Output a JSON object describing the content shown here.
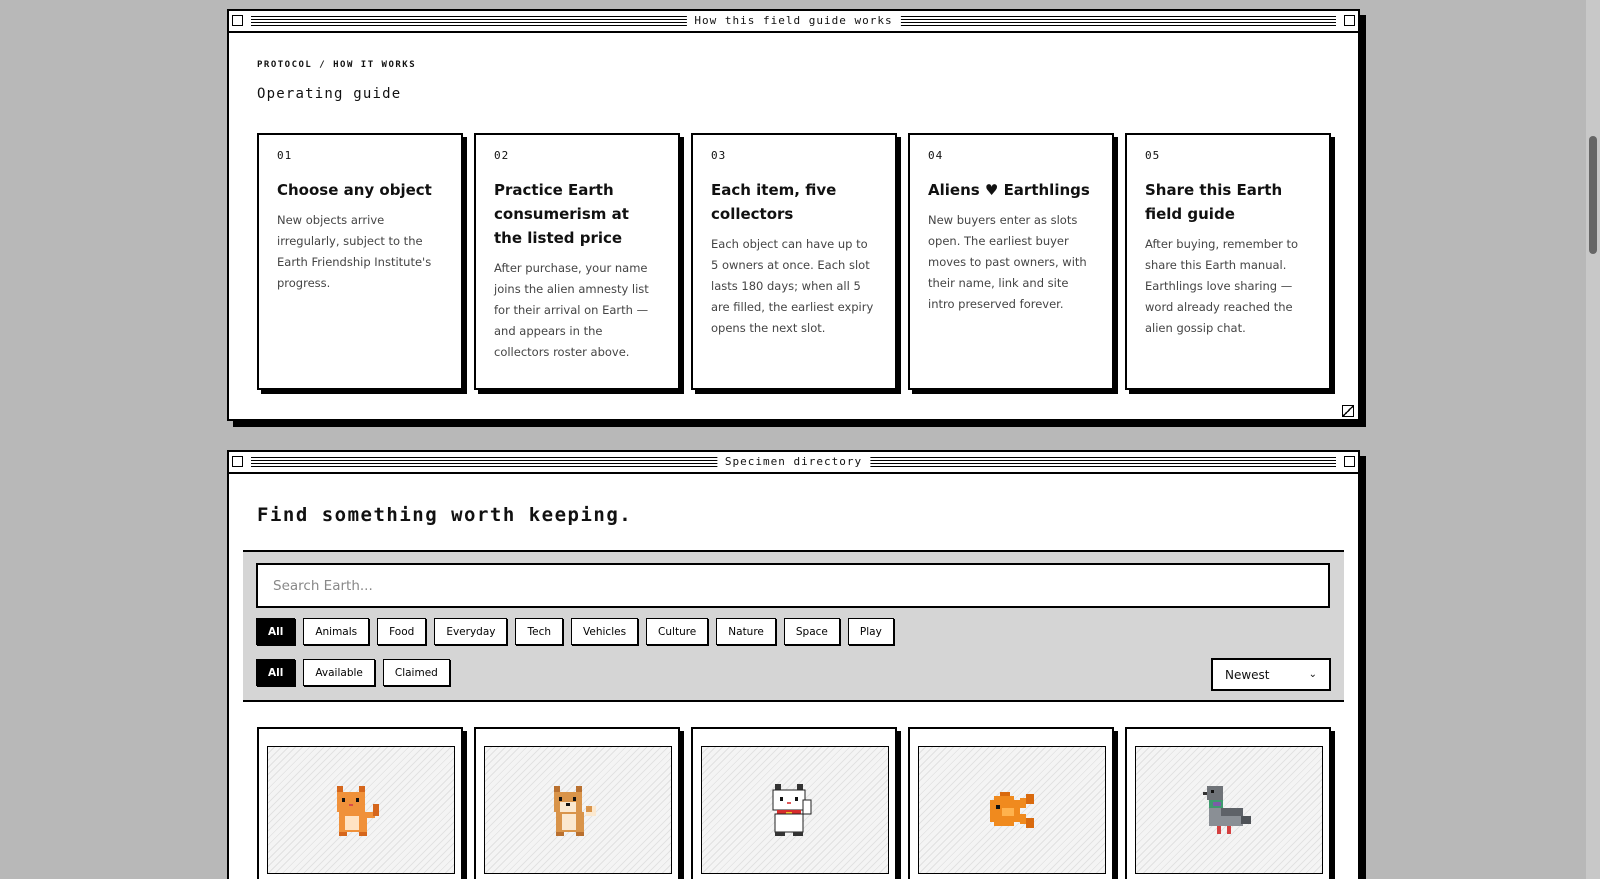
{
  "guide_window": {
    "title": "How this field guide works",
    "eyebrow": "PROTOCOL / HOW IT WORKS",
    "heading": "Operating guide",
    "steps": [
      {
        "num": "01",
        "title": "Choose any object",
        "body": "New objects arrive irregularly, subject to the Earth Friendship Institute's progress."
      },
      {
        "num": "02",
        "title": "Practice Earth consumerism at the listed price",
        "body": "After purchase, your name joins the alien amnesty list for their arrival on Earth — and appears in the collectors roster above."
      },
      {
        "num": "03",
        "title": "Each item, five collectors",
        "body": "Each object can have up to 5 owners at once. Each slot lasts 180 days; when all 5 are filled, the earliest expiry opens the next slot."
      },
      {
        "num": "04",
        "title": "Aliens ♥ Earthlings",
        "body": "New buyers enter as slots open. The earliest buyer moves to past owners, with their name, link and site intro preserved forever."
      },
      {
        "num": "05",
        "title": "Share this Earth field guide",
        "body": "After buying, remember to share this Earth manual. Earthlings love sharing — word already reached the alien gossip chat."
      }
    ]
  },
  "directory_window": {
    "title": "Specimen directory",
    "heading": "Find something worth keeping.",
    "search_placeholder": "Search Earth...",
    "categories": [
      "All",
      "Animals",
      "Food",
      "Everyday",
      "Tech",
      "Vehicles",
      "Culture",
      "Nature",
      "Space",
      "Play"
    ],
    "active_category": "All",
    "statuses": [
      "All",
      "Available",
      "Claimed"
    ],
    "active_status": "All",
    "sort_value": "Newest",
    "items": [
      {
        "icon": "orange-cat-icon"
      },
      {
        "icon": "shiba-dog-icon"
      },
      {
        "icon": "lucky-cat-icon"
      },
      {
        "icon": "goldfish-icon"
      },
      {
        "icon": "pigeon-icon"
      }
    ]
  },
  "colors": {
    "background": "#b8b8b8",
    "panel": "#d5d5d5",
    "ink": "#000000"
  }
}
